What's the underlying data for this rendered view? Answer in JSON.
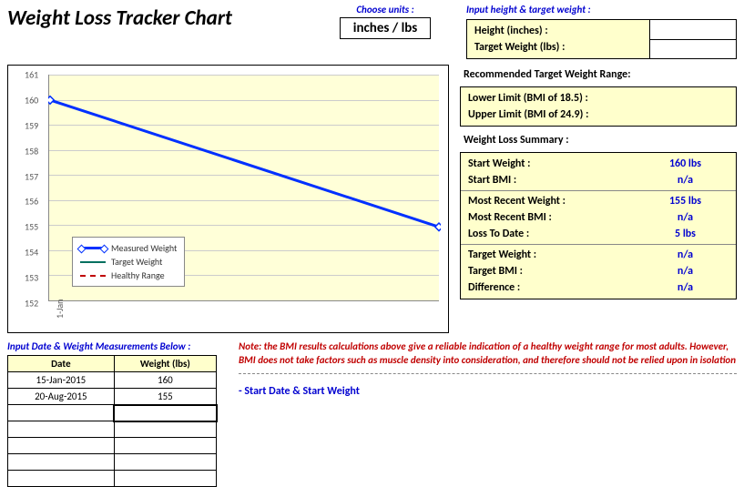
{
  "title": "Weight Loss Tracker Chart",
  "units": {
    "label": "Choose units :",
    "value": "inches / lbs"
  },
  "inputs_header": "Input height & target weight :",
  "height_label": "Height (inches) :",
  "target_weight_label": "Target Weight (lbs) :",
  "range_header": "Recommended Target Weight Range:",
  "lower_limit_label": "Lower Limit (BMI of 18.5) :",
  "upper_limit_label": "Upper Limit (BMI of 24.9) :",
  "summary_header": "Weight Loss Summary :",
  "summary": {
    "start_weight": {
      "label": "Start Weight :",
      "value": "160 lbs"
    },
    "start_bmi": {
      "label": "Start BMI :",
      "value": "n/a"
    },
    "recent_weight": {
      "label": "Most Recent Weight :",
      "value": "155 lbs"
    },
    "recent_bmi": {
      "label": "Most Recent BMI :",
      "value": "n/a"
    },
    "loss_to_date": {
      "label": "Loss To Date :",
      "value": "5 lbs"
    },
    "target_weight": {
      "label": "Target Weight :",
      "value": "n/a"
    },
    "target_bmi": {
      "label": "Target BMI :",
      "value": "n/a"
    },
    "difference": {
      "label": "Difference :",
      "value": "n/a"
    }
  },
  "legend": {
    "measured": "Measured Weight",
    "target": "Target Weight",
    "healthy": "Healthy Range"
  },
  "input_prompt": "Input Date & Weight Measurements Below :",
  "table": {
    "headers": {
      "date": "Date",
      "weight": "Weight (lbs)"
    },
    "rows": [
      {
        "date": "15-Jan-2015",
        "weight": "160"
      },
      {
        "date": "20-Aug-2015",
        "weight": "155"
      }
    ]
  },
  "note": "Note: the BMI results calculations above give a reliable indication of a healthy weight range for most adults. However, BMI does not take factors such as muscle density into consideration, and therefore should not be relied upon in isolation",
  "start_hint": "- Start Date & Start Weight",
  "xtick": "1-Jan",
  "chart_data": {
    "type": "line",
    "title": "",
    "xlabel": "",
    "ylabel": "",
    "ylim": [
      152,
      161
    ],
    "yticks": [
      152,
      153,
      154,
      155,
      156,
      157,
      158,
      159,
      160,
      161
    ],
    "x_tick_labels": [
      "1-Jan"
    ],
    "series": [
      {
        "name": "Measured Weight",
        "color": "#0030ff",
        "x": [
          "15-Jan-2015",
          "20-Aug-2015"
        ],
        "values": [
          160,
          155
        ]
      },
      {
        "name": "Target Weight",
        "color": "#007060",
        "x": [],
        "values": []
      },
      {
        "name": "Healthy Range",
        "color": "#c00000",
        "style": "dashed",
        "x": [],
        "values": []
      }
    ]
  }
}
